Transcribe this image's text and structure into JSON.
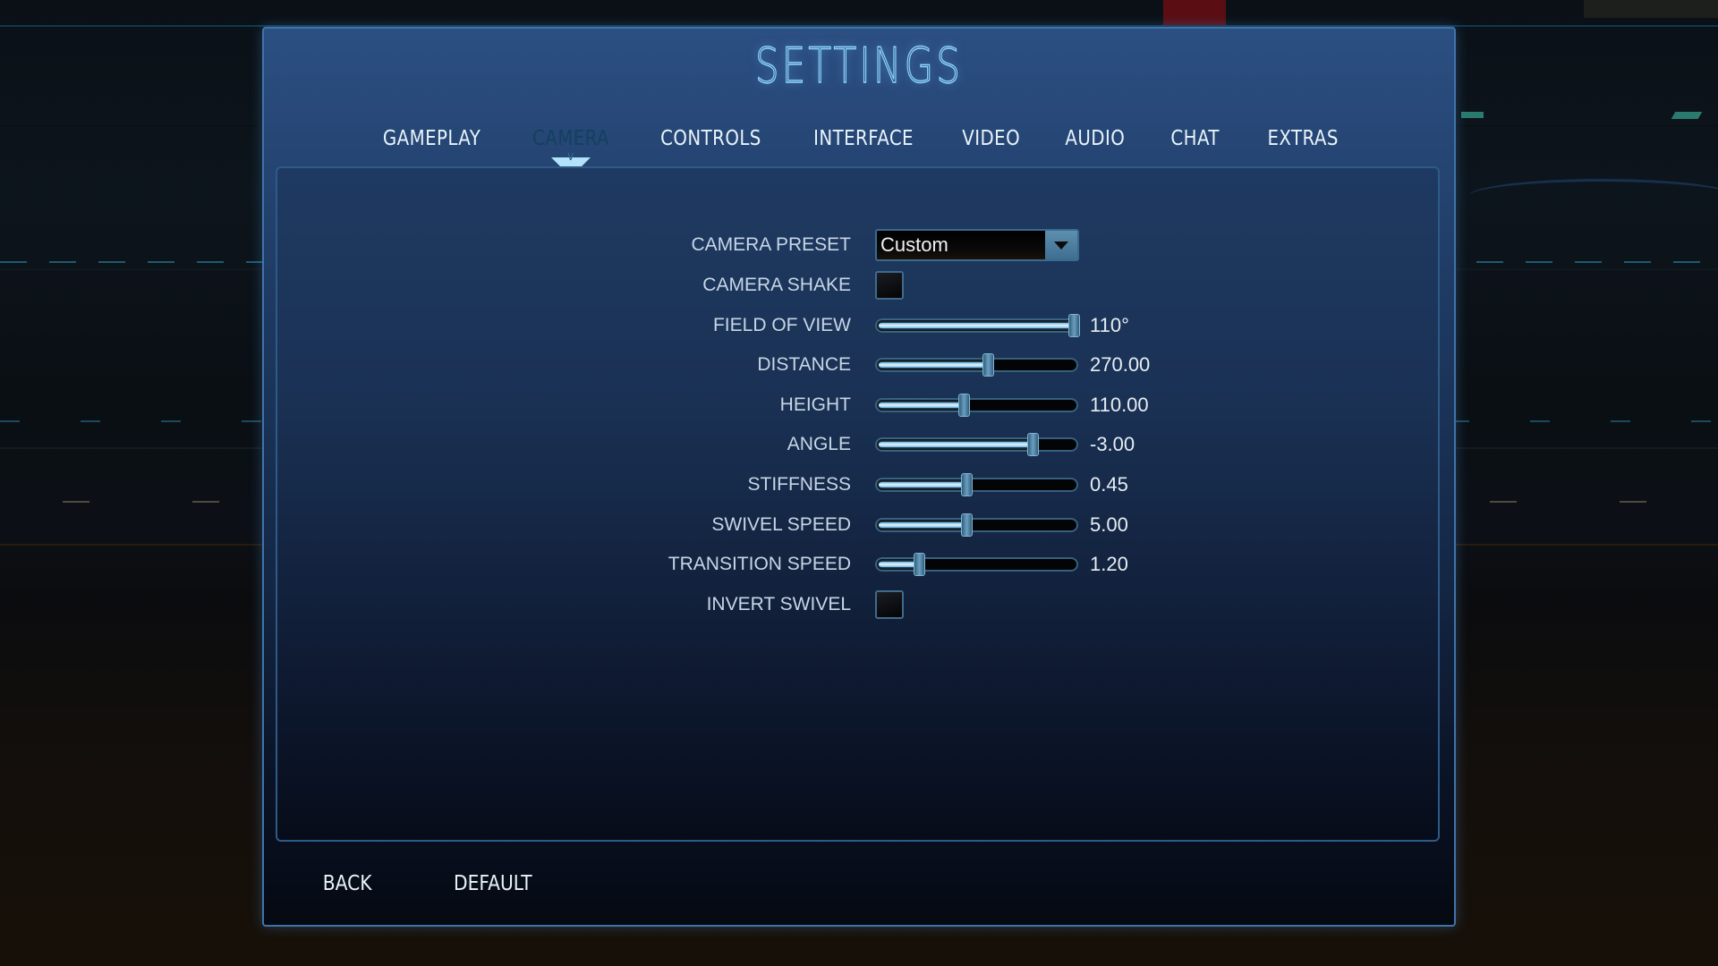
{
  "title": "SETTINGS",
  "tabs": [
    {
      "label": "GAMEPLAY",
      "active": false
    },
    {
      "label": "CAMERA",
      "active": true
    },
    {
      "label": "CONTROLS",
      "active": false
    },
    {
      "label": "INTERFACE",
      "active": false
    },
    {
      "label": "VIDEO",
      "active": false
    },
    {
      "label": "AUDIO",
      "active": false
    },
    {
      "label": "CHAT",
      "active": false
    },
    {
      "label": "EXTRAS",
      "active": false
    }
  ],
  "camera": {
    "preset": {
      "label": "CAMERA PRESET",
      "value": "Custom"
    },
    "shake": {
      "label": "CAMERA SHAKE",
      "checked": false
    },
    "sliders": [
      {
        "label": "FIELD OF VIEW",
        "value": "110°",
        "fraction": 1.0
      },
      {
        "label": "DISTANCE",
        "value": "270.00",
        "fraction": 0.56
      },
      {
        "label": "HEIGHT",
        "value": "110.00",
        "fraction": 0.44
      },
      {
        "label": "ANGLE",
        "value": "-3.00",
        "fraction": 0.79
      },
      {
        "label": "STIFFNESS",
        "value": "0.45",
        "fraction": 0.45
      },
      {
        "label": "SWIVEL SPEED",
        "value": "5.00",
        "fraction": 0.45
      },
      {
        "label": "TRANSITION SPEED",
        "value": "1.20",
        "fraction": 0.21
      }
    ],
    "invert_swivel": {
      "label": "INVERT SWIVEL",
      "checked": false
    }
  },
  "footer": {
    "back_label": "BACK",
    "default_label": "DEFAULT"
  },
  "colors": {
    "accent": "#8fd6ff",
    "active_tab": "#c7ecff",
    "panel": "#264776"
  }
}
